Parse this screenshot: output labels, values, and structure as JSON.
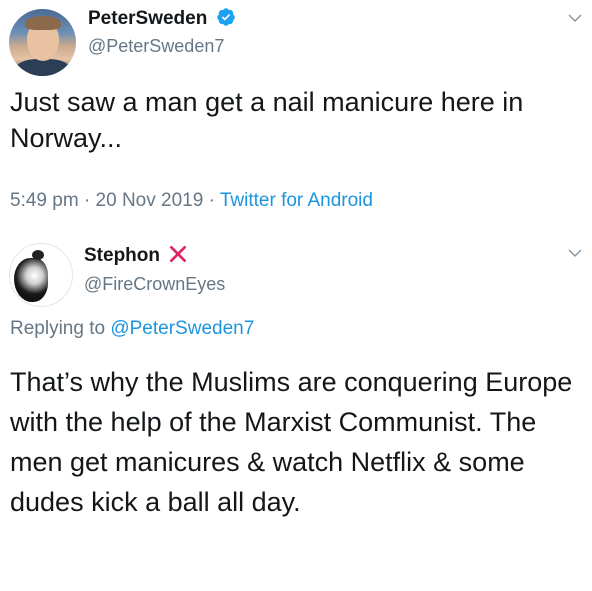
{
  "tweet_main": {
    "display_name": "PeterSweden",
    "handle": "@PeterSweden7",
    "text": "Just saw a man get a nail manicure here in Norway...",
    "time": "5:49 pm",
    "sep1": "·",
    "date": "20 Nov 2019",
    "sep2": "·",
    "source": "Twitter for Android",
    "verified_icon": "verified-badge-icon",
    "menu_icon": "chevron-down-icon"
  },
  "tweet_reply": {
    "display_name": "Stephon",
    "handle": "@FireCrownEyes",
    "replying_label": "Replying to",
    "replying_to": "@PeterSweden7",
    "text": "That’s why the Muslims are conquering Europe with the help of the Marxist Communist. The men get manicures & watch Netflix & some dudes kick a ball all day.",
    "badge_icon": "red-x-icon",
    "menu_icon": "chevron-down-icon"
  },
  "colors": {
    "text": "#14171a",
    "secondary": "#657786",
    "link": "#1b95e0",
    "verified": "#1da1f2",
    "x_mark": "#e0245e"
  }
}
